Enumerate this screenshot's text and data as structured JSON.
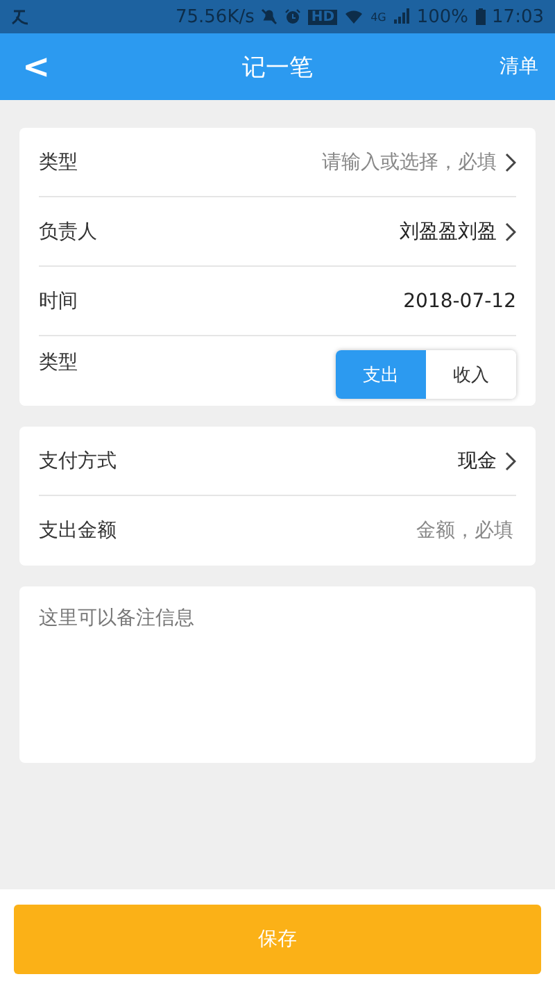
{
  "status_bar": {
    "speed": "75.56K/s",
    "hd": "HD",
    "network": "4G",
    "battery": "100%",
    "time": "17:03"
  },
  "header": {
    "back": "<",
    "title": "记一笔",
    "action": "清单"
  },
  "sections": [
    {
      "rows": [
        {
          "kind": "select",
          "label": "类型",
          "placeholder": "请输入或选择，必填"
        },
        {
          "kind": "select",
          "label": "负责人",
          "value": "刘盈盈刘盈"
        },
        {
          "kind": "text",
          "label": "时间",
          "value": "2018-07-12"
        },
        {
          "kind": "toggle",
          "label": "类型",
          "options": [
            {
              "label": "支出",
              "selected": true
            },
            {
              "label": "收入",
              "selected": false
            }
          ]
        }
      ]
    },
    {
      "rows": [
        {
          "kind": "select",
          "label": "支付方式",
          "value": "现金"
        },
        {
          "kind": "input",
          "label": "支出金额",
          "placeholder": "金额，必填"
        }
      ]
    }
  ],
  "note": {
    "placeholder": "这里可以备注信息"
  },
  "save_button": "保存"
}
